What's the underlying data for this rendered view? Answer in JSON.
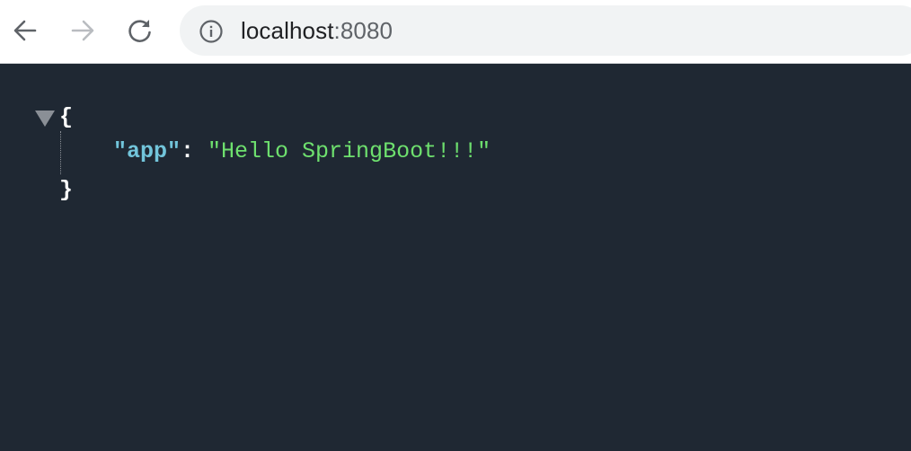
{
  "browser": {
    "nav": {
      "back_icon": "arrow-left-icon",
      "forward_icon": "arrow-right-icon",
      "reload_icon": "reload-icon",
      "forward_enabled": false
    },
    "address_bar": {
      "icon": "info-icon",
      "host": "localhost",
      "port": ":8080"
    }
  },
  "json_viewer": {
    "open_brace": "{",
    "close_brace": "}",
    "toggle_icon": "triangle-down-icon",
    "entries": [
      {
        "key": "\"app\"",
        "colon": ": ",
        "value": "\"Hello SpringBoot!!!\""
      }
    ]
  },
  "colors": {
    "viewer_background": "#1f2833",
    "key": "#72c5db",
    "string_value": "#6ee06e",
    "punctuation": "#ffffff",
    "toolbar_background": "#ffffff",
    "omnibox_background": "#f1f3f4"
  }
}
